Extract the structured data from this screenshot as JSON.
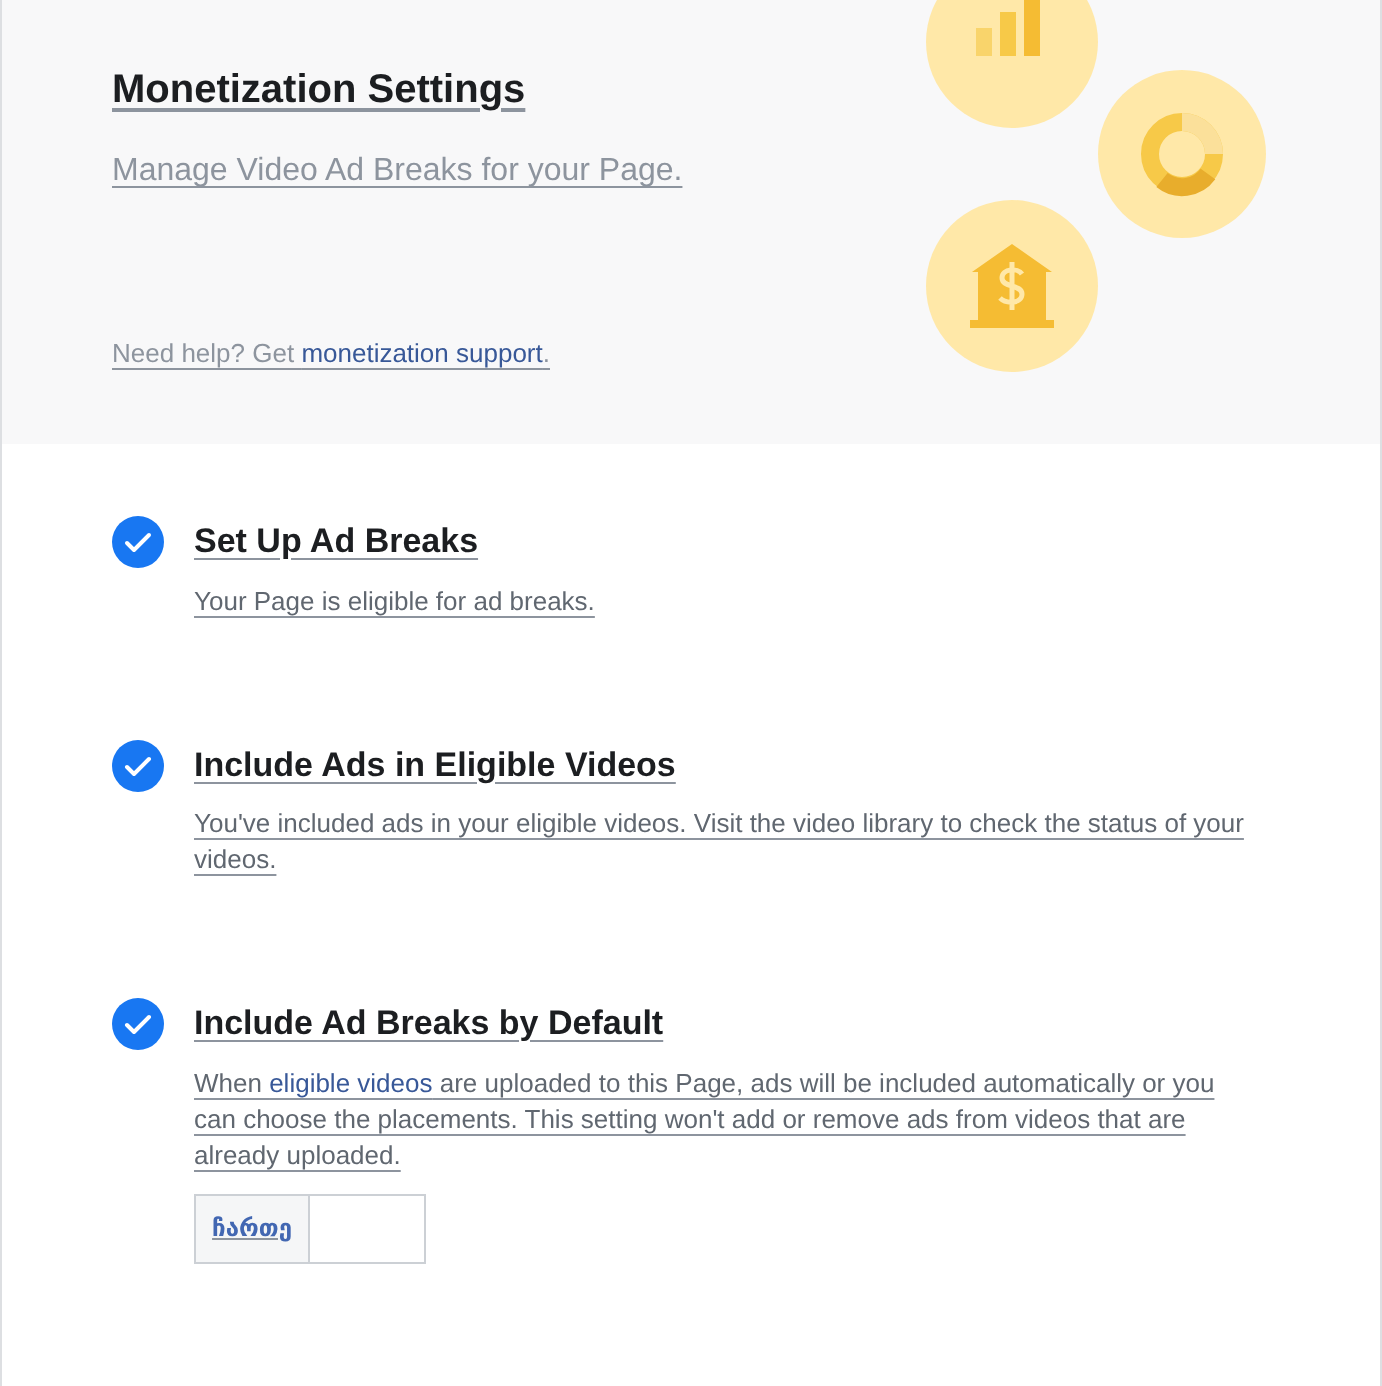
{
  "header": {
    "title": "Monetization Settings",
    "subtitle": "Manage Video Ad Breaks for your Page.",
    "help_text": "Need help? Get ",
    "help_link": "monetization support",
    "help_end": "."
  },
  "steps": [
    {
      "title": "Set Up Ad Breaks",
      "checked": true,
      "description": [
        {
          "kind": "text",
          "text": "Your Page is eligible for ad breaks."
        }
      ]
    },
    {
      "title": "Include Ads in Eligible Videos",
      "checked": true,
      "description": [
        {
          "kind": "text",
          "text": "You've included ads in your eligible videos. Visit the video library to check the status of your videos."
        }
      ]
    },
    {
      "title": "Include Ad Breaks by Default",
      "checked": true,
      "description": [
        {
          "kind": "text",
          "text": "When "
        },
        {
          "kind": "link",
          "text": "eligible videos"
        },
        {
          "kind": "text",
          "text": " are uploaded to this Page, ads will be included automatically or you can choose the placements. This setting won't add or remove ads from videos that are already uploaded."
        }
      ],
      "toggle": {
        "label": "ჩართე",
        "on": false
      }
    }
  ]
}
